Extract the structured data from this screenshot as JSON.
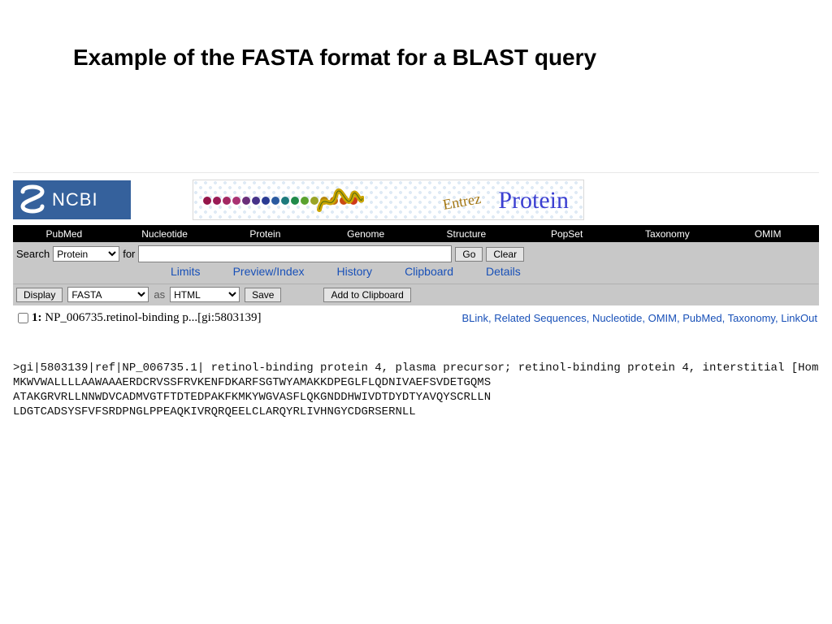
{
  "slide": {
    "title": "Example of the FASTA format for a BLAST query"
  },
  "logo": {
    "text": "NCBI"
  },
  "banner": {
    "entrez_label": "Entrez",
    "protein_label": "Protein",
    "bead_colors": [
      "#95164a",
      "#9a1c56",
      "#a32862",
      "#a93272",
      "#6a2e7a",
      "#463289",
      "#2a3b93",
      "#2a5aa0",
      "#1d7a7c",
      "#208a4a",
      "#5aa22f",
      "#9aa426",
      "#b6870e",
      "#c26610",
      "#ca4a14",
      "#cf3818"
    ]
  },
  "nav": {
    "items": [
      "PubMed",
      "Nucleotide",
      "Protein",
      "Genome",
      "Structure",
      "PopSet",
      "Taxonomy",
      "OMIM"
    ]
  },
  "search_bar": {
    "search_label": "Search",
    "for_label": "for",
    "db_options": [
      "Protein"
    ],
    "go_label": "Go",
    "clear_label": "Clear",
    "query_value": ""
  },
  "subnav": {
    "items": [
      "Limits",
      "Preview/Index",
      "History",
      "Clipboard",
      "Details"
    ]
  },
  "display_bar": {
    "display_label": "Display",
    "format_options": [
      "FASTA"
    ],
    "as_label": "as",
    "render_options": [
      "HTML"
    ],
    "save_label": "Save",
    "add_label": "Add to Clipboard"
  },
  "result": {
    "index_label": "1:",
    "title_prefix": "NP_006735.",
    "title_rest": " retinol-binding p...[gi:5803139]",
    "links": [
      "BLink",
      "Related Sequences",
      "Nucleotide",
      "OMIM",
      "PubMed",
      "Taxonomy",
      "LinkOut"
    ]
  },
  "fasta": {
    "line1": ">gi|5803139|ref|NP_006735.1| retinol-binding protein 4, plasma precursor; retinol-binding protein 4, interstitial [Hom",
    "line2": "MKWVWALLLLAAWAAAERDCRVSSFRVKENFDKARFSGTWYAMAKKDPEGLFLQDNIVAEFSVDETGQMS",
    "line3": "ATAKGRVRLLNNWDVCADMVGTFTDTEDPAKFKMKYWGVASFLQKGNDDHWIVDTDYDTYAVQYSCRLLN",
    "line4": "LDGTCADSYSFVFSRDPNGLPPEAQKIVRQRQEELCLARQYRLIVHNGYCDGRSERNLL"
  }
}
